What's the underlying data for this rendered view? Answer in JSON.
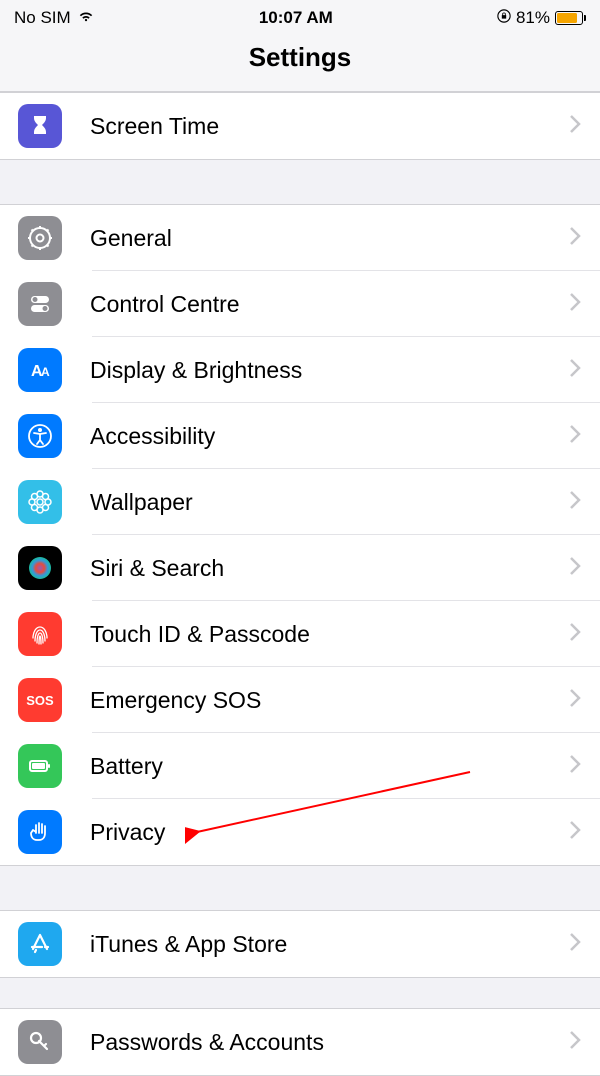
{
  "status": {
    "carrier": "No SIM",
    "time": "10:07 AM",
    "battery_pct": "81%"
  },
  "header": {
    "title": "Settings"
  },
  "groups": [
    {
      "items": [
        {
          "id": "screen-time",
          "label": "Screen Time",
          "icon": "hourglass-icon",
          "bg": "#5856d6"
        }
      ]
    },
    {
      "items": [
        {
          "id": "general",
          "label": "General",
          "icon": "gear-icon",
          "bg": "#8e8e93"
        },
        {
          "id": "control-centre",
          "label": "Control Centre",
          "icon": "toggles-icon",
          "bg": "#8e8e93"
        },
        {
          "id": "display-brightness",
          "label": "Display & Brightness",
          "icon": "text-size-icon",
          "bg": "#007aff"
        },
        {
          "id": "accessibility",
          "label": "Accessibility",
          "icon": "accessibility-icon",
          "bg": "#007aff"
        },
        {
          "id": "wallpaper",
          "label": "Wallpaper",
          "icon": "flower-icon",
          "bg": "#33bfe8"
        },
        {
          "id": "siri-search",
          "label": "Siri & Search",
          "icon": "siri-icon",
          "bg": "#000000"
        },
        {
          "id": "touch-id",
          "label": "Touch ID & Passcode",
          "icon": "fingerprint-icon",
          "bg": "#ff3b30"
        },
        {
          "id": "emergency-sos",
          "label": "Emergency SOS",
          "icon": "sos-icon",
          "bg": "#ff3b30"
        },
        {
          "id": "battery",
          "label": "Battery",
          "icon": "battery-icon",
          "bg": "#34c759"
        },
        {
          "id": "privacy",
          "label": "Privacy",
          "icon": "hand-icon",
          "bg": "#007aff"
        }
      ]
    },
    {
      "items": [
        {
          "id": "itunes-app-store",
          "label": "iTunes & App Store",
          "icon": "appstore-icon",
          "bg": "#1fa8ef"
        }
      ]
    },
    {
      "items": [
        {
          "id": "passwords-accounts",
          "label": "Passwords & Accounts",
          "icon": "key-icon",
          "bg": "#8e8e93"
        }
      ]
    }
  ],
  "annotation": {
    "target": "privacy",
    "color": "#ff0000"
  }
}
